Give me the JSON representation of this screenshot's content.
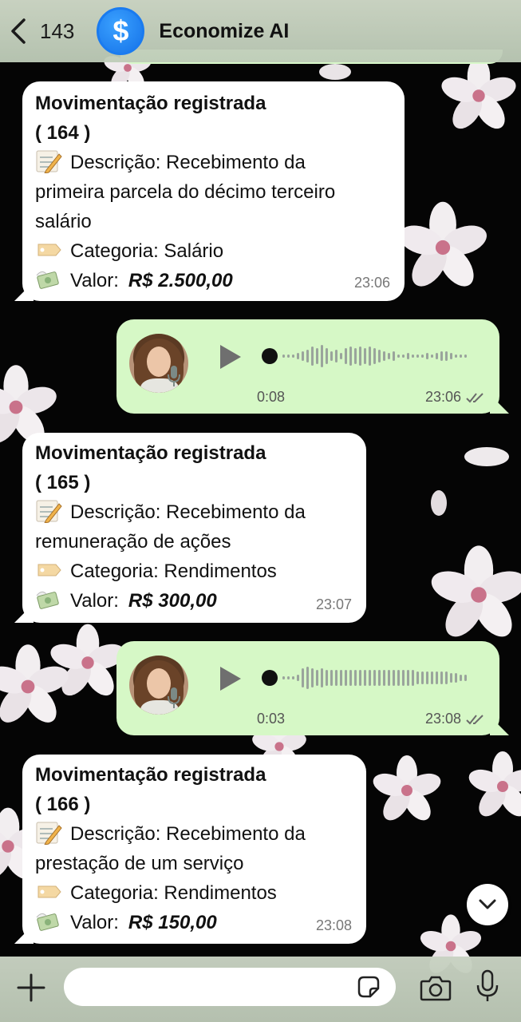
{
  "header": {
    "back_count": "143",
    "logo_symbol": "$",
    "title": "Economize AI"
  },
  "messages": [
    {
      "type": "incoming",
      "title": "Movimentação registrada",
      "id_line": "( 164 )",
      "description_lines": [
        "Descrição: Recebimento da",
        "primeira parcela do décimo terceiro",
        "salário"
      ],
      "category": "Categoria: Salário",
      "value_label": "Valor:",
      "value_amount": "R$ 2.500,00",
      "time": "23:06"
    },
    {
      "type": "voice",
      "duration": "0:08",
      "time": "23:06"
    },
    {
      "type": "incoming",
      "title": "Movimentação registrada",
      "id_line": "( 165 )",
      "description_lines": [
        "Descrição: Recebimento da",
        "remuneração de ações"
      ],
      "category": "Categoria: Rendimentos",
      "value_label": "Valor:",
      "value_amount": "R$ 300,00",
      "time": "23:07"
    },
    {
      "type": "voice",
      "duration": "0:03",
      "time": "23:08"
    },
    {
      "type": "incoming",
      "title": "Movimentação registrada",
      "id_line": "( 166 )",
      "description_lines": [
        "Descrição: Recebimento da",
        "prestação de um serviço"
      ],
      "category": "Categoria: Rendimentos",
      "value_label": "Valor:",
      "value_amount": "R$ 150,00",
      "time": "23:08"
    }
  ],
  "composer": {
    "placeholder": ""
  },
  "icons": {
    "back": "chevron-left-icon",
    "memo": "memo-emoji-icon",
    "tag": "label-tag-emoji-icon",
    "money": "money-wings-emoji-icon",
    "play": "play-icon",
    "mic": "microphone-icon",
    "read": "double-check-icon",
    "scroll": "chevron-down-icon",
    "plus": "plus-icon",
    "sticker": "sticker-icon",
    "camera": "camera-icon"
  },
  "colors": {
    "incoming_bubble": "#ffffff",
    "outgoing_bubble": "#d6f8c6",
    "logo": "#1572e8",
    "background": "#000000"
  }
}
